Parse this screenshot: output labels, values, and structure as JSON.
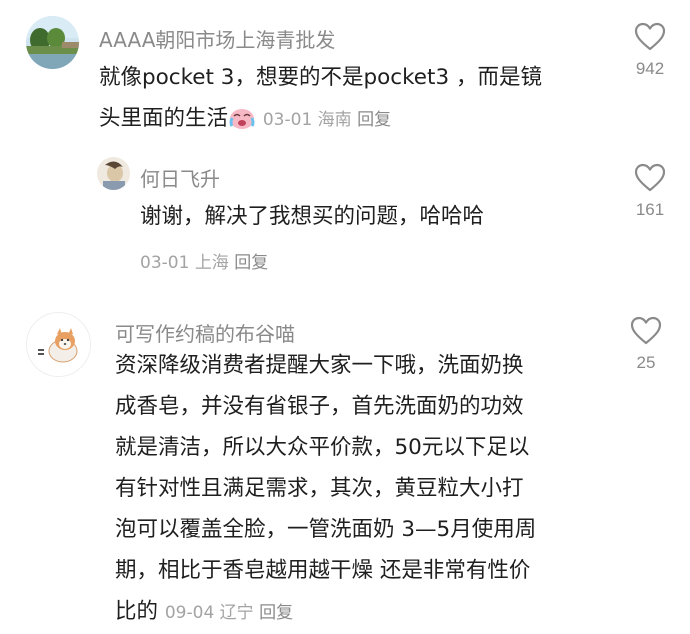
{
  "comments": [
    {
      "username": "AAAA朝阳市场上海青批发",
      "text": "就像pocket 3，想要的不是pocket3 ，而是镜\n头里面的生活",
      "emoji": "crying-face-emoji",
      "date": "03-01",
      "location": "海南",
      "reply_label": "回复",
      "likes": "942",
      "replies": [
        {
          "username": "何日飞升",
          "text": "谢谢，解决了我想买的问题，哈哈哈",
          "date": "03-01",
          "location": "上海",
          "reply_label": "回复",
          "likes": "161"
        }
      ]
    },
    {
      "username": "可写作约稿的布谷喵",
      "text": "资深降级消费者提醒大家一下哦，洗面奶换\n成香皂，并没有省银子，首先洗面奶的功效\n就是清洁，所以大众平价款，50元以下足以\n有针对性且满足需求，其次，黄豆粒大小打\n泡可以覆盖全脸，一管洗面奶 3—5月使用周\n期，相比于香皂越用越干燥 还是非常有性价\n比的",
      "date": "09-04",
      "location": "辽宁",
      "reply_label": "回复",
      "likes": "25"
    }
  ],
  "colors": {
    "text": "#1f1f1f",
    "username": "#8a8a8a",
    "meta": "#a3a3a3",
    "like_icon": "#8a8a8a"
  }
}
